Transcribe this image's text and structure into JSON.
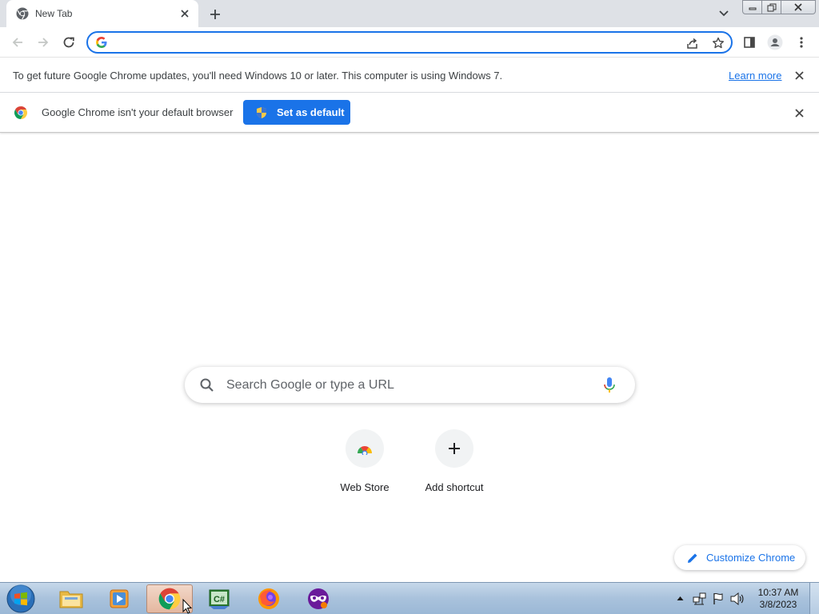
{
  "tabs": [
    {
      "title": "New Tab",
      "favicon": "chrome-icon"
    }
  ],
  "window_controls": [
    "minimize",
    "maximize",
    "close"
  ],
  "toolbar": {
    "back": "back-arrow-icon",
    "forward": "forward-arrow-icon",
    "reload": "reload-icon",
    "omnibox_value": "",
    "omnibox_icons": [
      "share-icon",
      "bookmark-star-icon"
    ],
    "side_panel": "side-panel-icon",
    "profile": "profile-icon",
    "menu": "kebab-menu-icon"
  },
  "infobar_update": {
    "text": "To get future Google Chrome updates, you'll need Windows 10 or later. This computer is using Windows 7.",
    "link": "Learn more"
  },
  "infobar_default": {
    "text": "Google Chrome isn't your default browser",
    "button": "Set as default"
  },
  "ntp": {
    "search_placeholder": "Search Google or type a URL",
    "shortcuts": [
      {
        "label": "Web Store",
        "icon": "web-store-icon"
      },
      {
        "label": "Add shortcut",
        "icon": "plus-icon"
      }
    ],
    "customize_label": "Customize Chrome"
  },
  "taskbar": {
    "items": [
      "start-orb",
      "file-explorer",
      "media-player",
      "chrome",
      "csharp-app",
      "firefox",
      "privacy-app"
    ],
    "clock_time": "10:37 AM",
    "clock_date": "3/8/2023"
  },
  "colors": {
    "accent": "#1a73e8",
    "tabstrip": "#dee1e6",
    "taskbar": "#a9c2dc"
  }
}
